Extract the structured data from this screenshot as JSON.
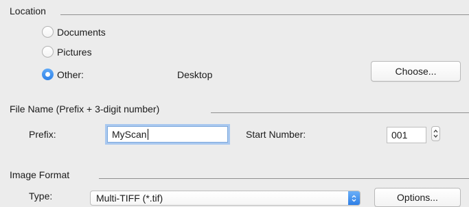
{
  "location": {
    "title": "Location",
    "options": [
      {
        "label": "Documents",
        "selected": false
      },
      {
        "label": "Pictures",
        "selected": false
      },
      {
        "label": "Other:",
        "selected": true
      }
    ],
    "other_value": "Desktop",
    "choose_label": "Choose..."
  },
  "file_name": {
    "title": "File Name (Prefix + 3-digit number)",
    "prefix_label": "Prefix:",
    "prefix_value": "MyScan",
    "start_label": "Start Number:",
    "start_value": "001"
  },
  "image_format": {
    "title": "Image Format",
    "type_label": "Type:",
    "type_value": "Multi-TIFF (*.tif)",
    "options_label": "Options..."
  },
  "colors": {
    "accent": "#2f82e8",
    "focus_ring": "#a9c8ef",
    "background": "#ececec"
  }
}
